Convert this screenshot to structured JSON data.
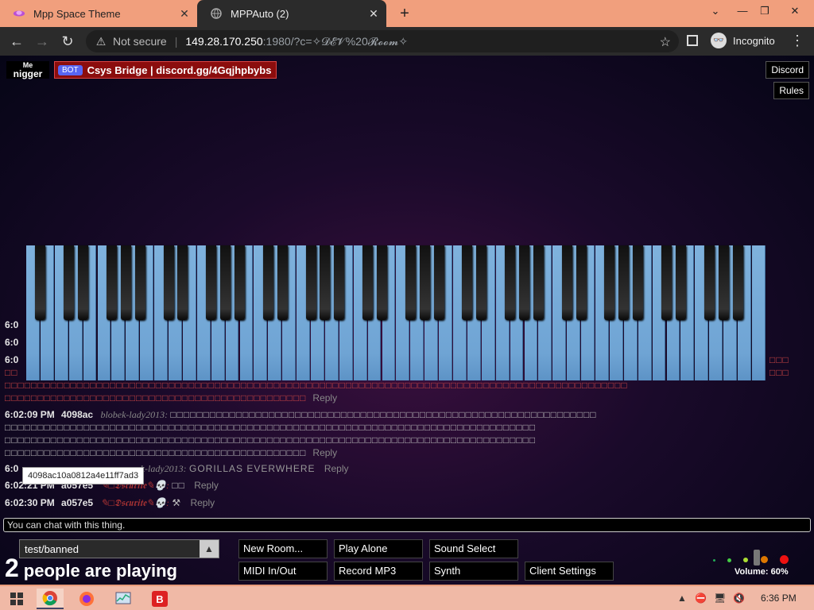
{
  "browser": {
    "tabs": [
      {
        "title": "Mpp Space Theme",
        "active": false
      },
      {
        "title": "MPPAuto (2)",
        "active": true
      }
    ],
    "new_tab": "+",
    "window_controls": {
      "minimize": "⌄",
      "min2": "—",
      "restore": "❐",
      "close": "✕"
    },
    "nav": {
      "back": "←",
      "forward": "→",
      "reload": "↻"
    },
    "security_label": "Not secure",
    "url_host": "149.28.170.250",
    "url_path": ":1980/?c=✧𝓓𝓔𝓥%20𝓡𝓸𝓸𝓶✧",
    "incognito_label": "Incognito"
  },
  "page": {
    "me": {
      "label": "Me",
      "name": "nigger"
    },
    "bot": {
      "badge": "BOT",
      "name": "Csys Bridge | discord.gg/4Gqjhpbybs"
    },
    "top_buttons": {
      "discord": "Discord",
      "rules": "Rules"
    },
    "chat": {
      "lines": [
        {
          "time": "6:0",
          "text": ""
        },
        {
          "time": "6:0",
          "text": ""
        },
        {
          "time": "6:0",
          "text": ""
        },
        {
          "boxes_right": "□□□"
        },
        {
          "boxes_left": "□□",
          "boxes_right": "□□□"
        },
        {
          "boxes": "□□□□□□□□□□□□□□□□□□□□□□□□□□□□□□□□□□□□□□□□□□□□□□□□□□□□□□□□□□□□□□□□□□□□□□□□□□□□□□□□□□□□□□□□□□□□□□□"
        },
        {
          "boxes": "□□□□□□□□□□□□□□□□□□□□□□□□□□□□□□□□□□□□□□□□□□□□□□",
          "reply": "Reply"
        },
        {
          "time": "6:02:09 PM",
          "uid": "4098ac",
          "uname": "blobek-lady2013:",
          "msg": "□□□□□□□□□□□□□□□□□□□□□□□□□□□□□□□□□□□□□□□□□□□□□□□□□□□□□□□□□□□□□□□□□"
        },
        {
          "msg": "□□□□□□□□□□□□□□□□□□□□□□□□□□□□□□□□□□□□□□□□□□□□□□□□□□□□□□□□□□□□□□□□□□□□□□□□□□□□□□□□□"
        },
        {
          "msg": "□□□□□□□□□□□□□□□□□□□□□□□□□□□□□□□□□□□□□□□□□□□□□□□□□□□□□□□□□□□□□□□□□□□□□□□□□□□□□□□□□"
        },
        {
          "msg": "□□□□□□□□□□□□□□□□□□□□□□□□□□□□□□□□□□□□□□□□□□□□□□",
          "reply": "Reply"
        },
        {
          "time": "6:0",
          "uname": "k-lady2013:",
          "msg": "GORILLAS EVERWHERE",
          "reply": "Reply"
        },
        {
          "time": "6:02:21 PM",
          "uid": "a057e5",
          "uname": "✎□𝕯𝖘𝖈𝖚𝖗𝖎𝖙𝖊✎💀:",
          "msg": "□□",
          "reply": "Reply"
        },
        {
          "time": "6:02:30 PM",
          "uid": "a057e5",
          "uname": "✎□𝕯𝖘𝖈𝖚𝖗𝖎𝖙𝖊✎💀:",
          "msg": "⚒",
          "reply": "Reply"
        }
      ],
      "tooltip": "4098ac10a0812a4e11ff7ad3",
      "input_placeholder": "You can chat with this thing."
    },
    "room": {
      "name": "test/banned",
      "arrow": "▲"
    },
    "players": {
      "count": "2",
      "text": "people are playing"
    },
    "buttons": {
      "new_room": "New Room...",
      "play_alone": "Play Alone",
      "sound_select": "Sound Select",
      "midi": "MIDI In/Out",
      "record": "Record MP3",
      "synth": "Synth",
      "client_settings": "Client Settings"
    },
    "volume": "Volume: 60%"
  },
  "taskbar": {
    "time": "6:36 PM"
  }
}
